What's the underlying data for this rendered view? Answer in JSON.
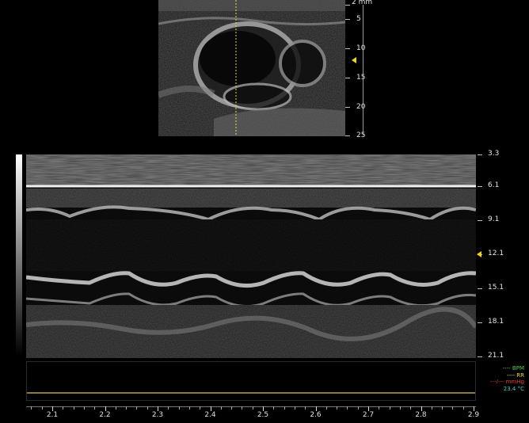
{
  "colors": {
    "marker": "#f2d21a",
    "bpm": "#4bd04b",
    "rr": "#e6e21d",
    "mmhg": "#e23b3b",
    "temp": "#3fd2c7"
  },
  "bmode": {
    "depth_unit_label": "2 mm",
    "depth_ticks": [
      "5",
      "10",
      "15",
      "20",
      "25"
    ]
  },
  "mmode": {
    "depth_ticks": [
      "3.3",
      "6.1",
      "9.1",
      "12.1",
      "15.1",
      "18.1",
      "21.1"
    ]
  },
  "time_axis": {
    "labels": [
      "2.1",
      "2.2",
      "2.3",
      "2.4",
      "2.5",
      "2.6",
      "2.7",
      "2.8",
      "2.9"
    ]
  },
  "legend": {
    "bpm": "---- BPM",
    "rr": "---- RR",
    "mmhg": "---/--- mmHg",
    "temp": "23.4 °C"
  }
}
